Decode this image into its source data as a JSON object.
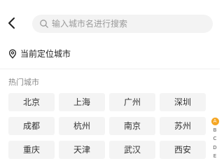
{
  "header": {
    "back_icon": "chevron-left-icon",
    "search": {
      "placeholder": "输入城市名进行搜索",
      "value": "",
      "icon": "search-icon"
    }
  },
  "location": {
    "icon": "location-pin-icon",
    "label": "当前定位城市"
  },
  "hot_cities": {
    "title": "热门城市",
    "items": [
      {
        "label": "北京"
      },
      {
        "label": "上海"
      },
      {
        "label": "广州"
      },
      {
        "label": "深圳"
      },
      {
        "label": "成都"
      },
      {
        "label": "杭州"
      },
      {
        "label": "南京"
      },
      {
        "label": "苏州"
      },
      {
        "label": "重庆"
      },
      {
        "label": "天津"
      },
      {
        "label": "武汉"
      },
      {
        "label": "西安"
      }
    ]
  },
  "alpha_index": {
    "letters": [
      "A",
      "B",
      "C",
      "D",
      "E"
    ],
    "active": "A",
    "active_color": "#f5a623"
  }
}
